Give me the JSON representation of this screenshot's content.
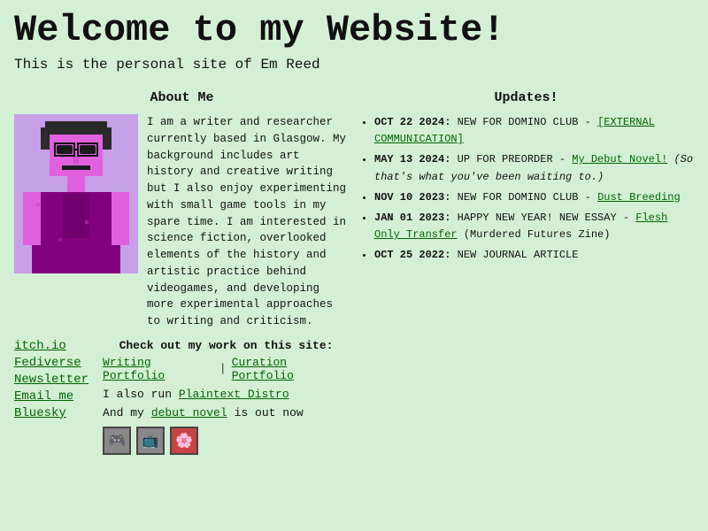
{
  "header": {
    "title": "Welcome to my Website!",
    "subtitle": "This is the personal site of Em Reed"
  },
  "about": {
    "section_title": "About Me",
    "body": "I am a writer and researcher currently based in Glasgow. My background includes art history and creative writing but I also enjoy experimenting with small game tools in my spare time. I am interested in science fiction, overlooked elements of the history and artistic practice behind videogames, and developing more experimental approaches to writing and criticism."
  },
  "links": {
    "check_label": "Check out my work on this site:",
    "items_left": [
      "itch.io",
      "Fediverse",
      "Newsletter",
      "Email me",
      "Bluesky"
    ],
    "writing_portfolio": "Writing Portfolio",
    "curation_portfolio": "Curation Portfolio",
    "also_run": "I also run",
    "plaintext_distro": "Plaintext Distro",
    "debut_text": "And my",
    "debut_link": "debut novel",
    "debut_end": "is out now"
  },
  "updates": {
    "section_title": "Updates!",
    "items": [
      {
        "date": "OCT 22 2024:",
        "prefix": "NEW FOR DOMINO CLUB -",
        "link_text": "[EXTERNAL COMMUNICATION]",
        "link_url": "#"
      },
      {
        "date": "MAY 13 2024:",
        "prefix": "UP FOR PREORDER -",
        "link_text": "My Debut Novel!",
        "link_url": "#",
        "suffix": "(So that's what you've been waiting to.)"
      },
      {
        "date": "NOV 10 2023:",
        "prefix": "NEW FOR DOMINO CLUB -",
        "link_text": "Dust Breeding",
        "link_url": "#"
      },
      {
        "date": "JAN 01 2023:",
        "prefix": "HAPPY NEW YEAR! NEW ESSAY -",
        "link_text": "Flesh Only Transfer",
        "link_url": "#",
        "suffix": "(Murdered Futures Zine)"
      },
      {
        "date": "OCT 25 2022:",
        "prefix": "NEW JOURNAL ARTICLE",
        "link_text": "",
        "link_url": "#"
      }
    ]
  }
}
